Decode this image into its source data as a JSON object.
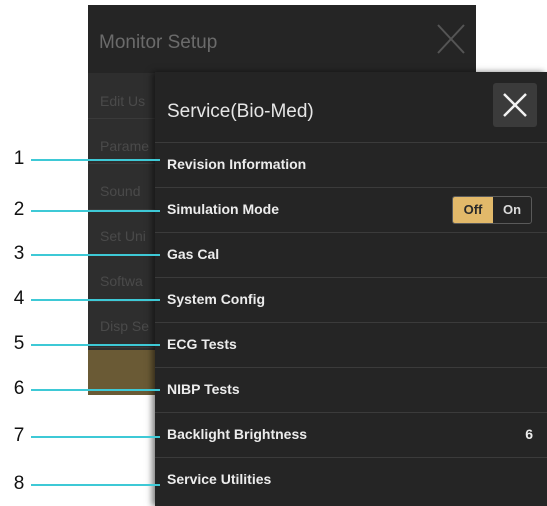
{
  "background_panel": {
    "title": "Monitor Setup",
    "items": [
      "Edit Us",
      "Parame",
      "Sound",
      "Set Uni",
      "Softwa",
      "Disp Se"
    ]
  },
  "panel": {
    "title": "Service(Bio-Med)",
    "items": [
      {
        "label": "Revision Information"
      },
      {
        "label": "Simulation Mode",
        "toggle": {
          "off": "Off",
          "on": "On",
          "selected": "Off"
        }
      },
      {
        "label": "Gas Cal"
      },
      {
        "label": "System Config"
      },
      {
        "label": "ECG Tests"
      },
      {
        "label": "NIBP Tests"
      },
      {
        "label": "Backlight Brightness",
        "value": "6"
      },
      {
        "label": "Service Utilities"
      }
    ]
  },
  "callouts": [
    "1",
    "2",
    "3",
    "4",
    "5",
    "6",
    "7",
    "8"
  ],
  "colors": {
    "callout_line": "#3ec9d6",
    "toggle_selected": "#e2b96a",
    "panel_bg": "#252525"
  }
}
